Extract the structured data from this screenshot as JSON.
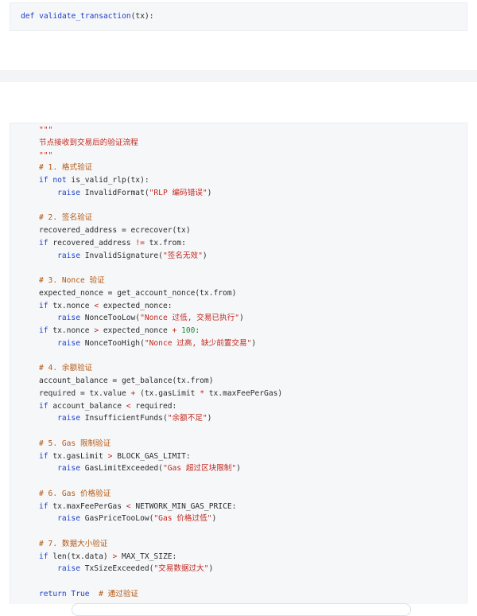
{
  "header": {
    "def_keyword": "def",
    "function_name": "validate_transaction",
    "signature_rest": "(tx):"
  },
  "lines": [
    [
      {
        "t": "\"\"\"",
        "c": "str"
      }
    ],
    [
      {
        "t": "节点接收到交易后的验证流程",
        "c": "str"
      }
    ],
    [
      {
        "t": "\"\"\"",
        "c": "str"
      }
    ],
    [
      {
        "t": "# 1. 格式验证",
        "c": "cm"
      }
    ],
    [
      {
        "t": "if not",
        "c": "kw"
      },
      {
        "t": " is_valid_rlp(tx):",
        "c": "plain"
      }
    ],
    [
      {
        "t": "    raise",
        "c": "kw"
      },
      {
        "t": " InvalidFormat(",
        "c": "plain"
      },
      {
        "t": "\"RLP 编码错误\"",
        "c": "str"
      },
      {
        "t": ")",
        "c": "plain"
      }
    ],
    [
      {
        "t": "",
        "c": "plain"
      }
    ],
    [
      {
        "t": "# 2. 签名验证",
        "c": "cm"
      }
    ],
    [
      {
        "t": "recovered_address = ecrecover(tx)",
        "c": "plain"
      }
    ],
    [
      {
        "t": "if",
        "c": "kw"
      },
      {
        "t": " recovered_address ",
        "c": "plain"
      },
      {
        "t": "!=",
        "c": "op"
      },
      {
        "t": " tx.from:",
        "c": "plain"
      }
    ],
    [
      {
        "t": "    raise",
        "c": "kw"
      },
      {
        "t": " InvalidSignature(",
        "c": "plain"
      },
      {
        "t": "\"签名无效\"",
        "c": "str"
      },
      {
        "t": ")",
        "c": "plain"
      }
    ],
    [
      {
        "t": "",
        "c": "plain"
      }
    ],
    [
      {
        "t": "# 3. Nonce 验证",
        "c": "cm"
      }
    ],
    [
      {
        "t": "expected_nonce = get_account_nonce(tx.from)",
        "c": "plain"
      }
    ],
    [
      {
        "t": "if",
        "c": "kw"
      },
      {
        "t": " tx.nonce ",
        "c": "plain"
      },
      {
        "t": "<",
        "c": "op"
      },
      {
        "t": " expected_nonce:",
        "c": "plain"
      }
    ],
    [
      {
        "t": "    raise",
        "c": "kw"
      },
      {
        "t": " NonceTooLow(",
        "c": "plain"
      },
      {
        "t": "\"Nonce 过低, 交易已执行\"",
        "c": "str"
      },
      {
        "t": ")",
        "c": "plain"
      }
    ],
    [
      {
        "t": "if",
        "c": "kw"
      },
      {
        "t": " tx.nonce ",
        "c": "plain"
      },
      {
        "t": ">",
        "c": "op"
      },
      {
        "t": " expected_nonce ",
        "c": "plain"
      },
      {
        "t": "+",
        "c": "op"
      },
      {
        "t": " ",
        "c": "plain"
      },
      {
        "t": "100",
        "c": "num"
      },
      {
        "t": ":",
        "c": "plain"
      }
    ],
    [
      {
        "t": "    raise",
        "c": "kw"
      },
      {
        "t": " NonceTooHigh(",
        "c": "plain"
      },
      {
        "t": "\"Nonce 过高, 缺少前置交易\"",
        "c": "str"
      },
      {
        "t": ")",
        "c": "plain"
      }
    ],
    [
      {
        "t": "",
        "c": "plain"
      }
    ],
    [
      {
        "t": "# 4. 余额验证",
        "c": "cm"
      }
    ],
    [
      {
        "t": "account_balance = get_balance(tx.from)",
        "c": "plain"
      }
    ],
    [
      {
        "t": "required = tx.value ",
        "c": "plain"
      },
      {
        "t": "+",
        "c": "op"
      },
      {
        "t": " (tx.gasLimit ",
        "c": "plain"
      },
      {
        "t": "*",
        "c": "op"
      },
      {
        "t": " tx.maxFeePerGas)",
        "c": "plain"
      }
    ],
    [
      {
        "t": "if",
        "c": "kw"
      },
      {
        "t": " account_balance ",
        "c": "plain"
      },
      {
        "t": "<",
        "c": "op"
      },
      {
        "t": " required:",
        "c": "plain"
      }
    ],
    [
      {
        "t": "    raise",
        "c": "kw"
      },
      {
        "t": " InsufficientFunds(",
        "c": "plain"
      },
      {
        "t": "\"余额不足\"",
        "c": "str"
      },
      {
        "t": ")",
        "c": "plain"
      }
    ],
    [
      {
        "t": "",
        "c": "plain"
      }
    ],
    [
      {
        "t": "# 5. Gas 限制验证",
        "c": "cm"
      }
    ],
    [
      {
        "t": "if",
        "c": "kw"
      },
      {
        "t": " tx.gasLimit ",
        "c": "plain"
      },
      {
        "t": ">",
        "c": "op"
      },
      {
        "t": " BLOCK_GAS_LIMIT:",
        "c": "plain"
      }
    ],
    [
      {
        "t": "    raise",
        "c": "kw"
      },
      {
        "t": " GasLimitExceeded(",
        "c": "plain"
      },
      {
        "t": "\"Gas 超过区块限制\"",
        "c": "str"
      },
      {
        "t": ")",
        "c": "plain"
      }
    ],
    [
      {
        "t": "",
        "c": "plain"
      }
    ],
    [
      {
        "t": "# 6. Gas 价格验证",
        "c": "cm"
      }
    ],
    [
      {
        "t": "if",
        "c": "kw"
      },
      {
        "t": " tx.maxFeePerGas ",
        "c": "plain"
      },
      {
        "t": "<",
        "c": "op"
      },
      {
        "t": " NETWORK_MIN_GAS_PRICE:",
        "c": "plain"
      }
    ],
    [
      {
        "t": "    raise",
        "c": "kw"
      },
      {
        "t": " GasPriceTooLow(",
        "c": "plain"
      },
      {
        "t": "\"Gas 价格过低\"",
        "c": "str"
      },
      {
        "t": ")",
        "c": "plain"
      }
    ],
    [
      {
        "t": "",
        "c": "plain"
      }
    ],
    [
      {
        "t": "# 7. 数据大小验证",
        "c": "cm"
      }
    ],
    [
      {
        "t": "if",
        "c": "kw"
      },
      {
        "t": " len(tx.data) ",
        "c": "plain"
      },
      {
        "t": ">",
        "c": "op"
      },
      {
        "t": " MAX_TX_SIZE:",
        "c": "plain"
      }
    ],
    [
      {
        "t": "    raise",
        "c": "kw"
      },
      {
        "t": " TxSizeExceeded(",
        "c": "plain"
      },
      {
        "t": "\"交易数据过大\"",
        "c": "str"
      },
      {
        "t": ")",
        "c": "plain"
      }
    ],
    [
      {
        "t": "",
        "c": "plain"
      }
    ],
    [
      {
        "t": "return True",
        "c": "kw"
      },
      {
        "t": "  # 通过验证",
        "c": "cm"
      }
    ]
  ]
}
